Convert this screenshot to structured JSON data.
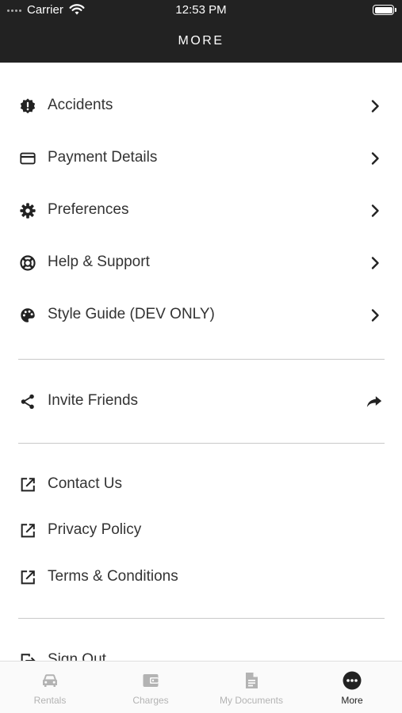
{
  "status_bar": {
    "carrier": "Carrier",
    "time": "12:53 PM"
  },
  "header": {
    "title": "MORE"
  },
  "menu": {
    "accidents": "Accidents",
    "payment": "Payment Details",
    "preferences": "Preferences",
    "help": "Help & Support",
    "style_guide": "Style Guide (DEV ONLY)",
    "invite": "Invite Friends",
    "contact": "Contact Us",
    "privacy": "Privacy Policy",
    "terms": "Terms & Conditions",
    "sign_out": "Sign Out"
  },
  "tabs": {
    "rentals": "Rentals",
    "charges": "Charges",
    "documents": "My Documents",
    "more": "More",
    "active": "More"
  },
  "colors": {
    "header_bg": "#222222",
    "text": "#333333",
    "tab_inactive": "#b3b3b3",
    "tab_active": "#222222"
  }
}
